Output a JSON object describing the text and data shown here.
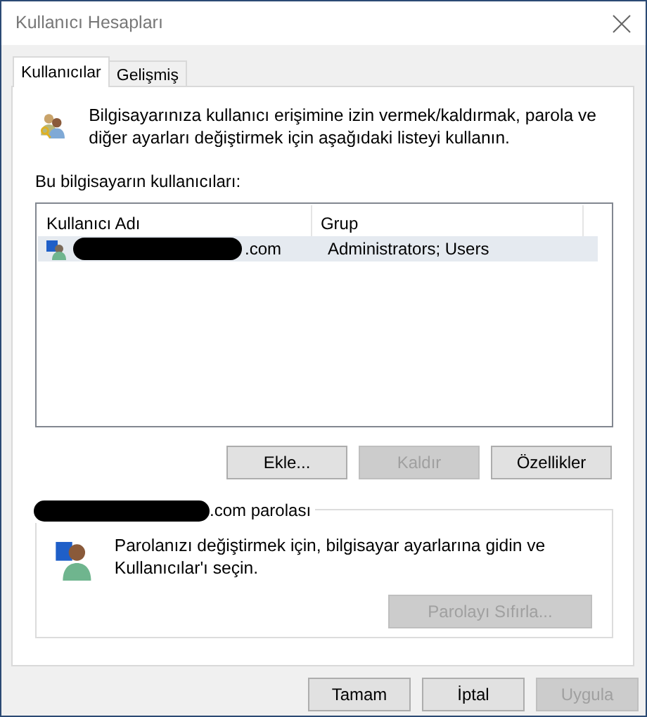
{
  "window": {
    "title": "Kullanıcı Hesapları"
  },
  "tabs": [
    {
      "label": "Kullanıcılar",
      "selected": true
    },
    {
      "label": "Gelişmiş",
      "selected": false
    }
  ],
  "intro": "Bilgisayarınıza kullanıcı erişimine izin vermek/kaldırmak, parola ve diğer ayarları değiştirmek için aşağıdaki listeyi kullanın.",
  "users_label": "Bu bilgisayarın kullanıcıları:",
  "table": {
    "columns": [
      "Kullanıcı Adı",
      "Grup"
    ],
    "rows": [
      {
        "name": ".com",
        "group": "Administrators; Users",
        "selected": true
      }
    ]
  },
  "user_buttons": [
    {
      "label": "Ekle...",
      "disabled": false
    },
    {
      "label": "Kaldır",
      "disabled": true
    },
    {
      "label": "Özellikler",
      "disabled": false
    }
  ],
  "password": {
    "title": ".com parolası",
    "text": "Parolanızı değiştirmek için, bilgisayar ayarlarına gidin ve Kullanıcılar'ı seçin.",
    "button": {
      "label": "Parolayı Sıfırla...",
      "disabled": true
    }
  },
  "footer_buttons": [
    {
      "label": "Tamam",
      "disabled": false
    },
    {
      "label": "İptal",
      "disabled": false
    },
    {
      "label": "Uygula",
      "disabled": true
    }
  ]
}
